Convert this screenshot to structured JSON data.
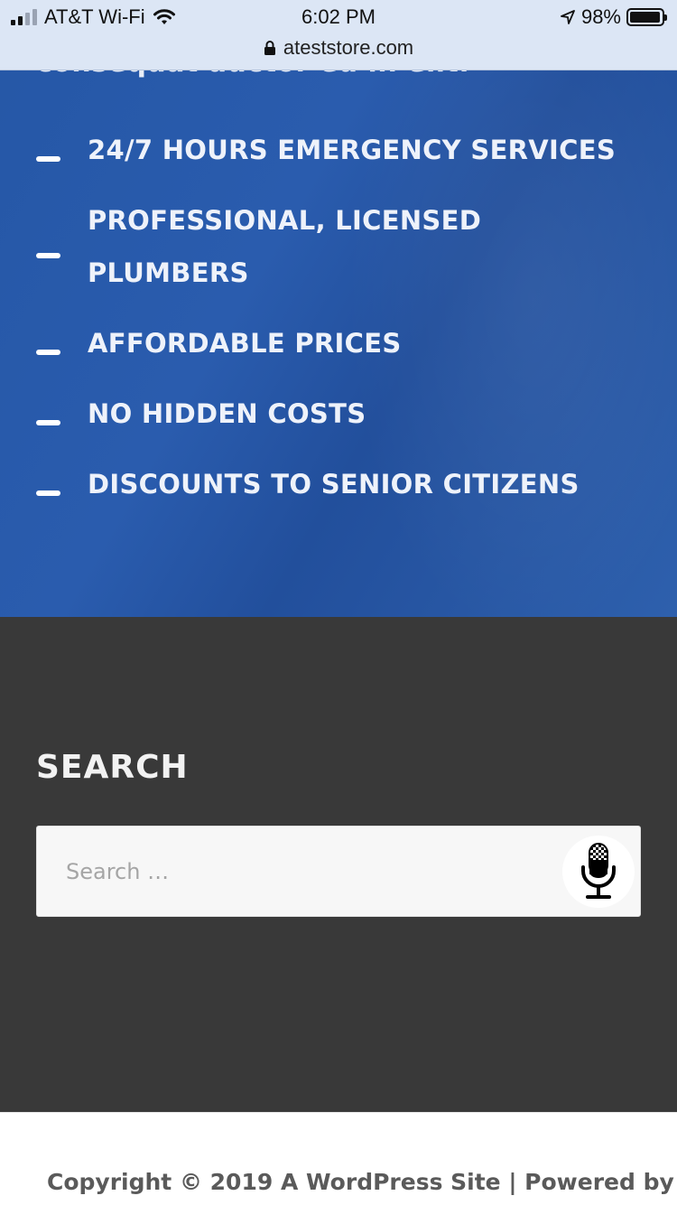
{
  "status_bar": {
    "carrier": "AT&T Wi-Fi",
    "time": "6:02 PM",
    "battery": "98%",
    "battery_level": 0.98,
    "url": "ateststore.com"
  },
  "features": {
    "cut_off_text": "consequat auctor eu in elit.",
    "items": [
      {
        "label": "24/7 HOURS EMERGENCY SERVICES"
      },
      {
        "label": "PROFESSIONAL, LICENSED PLUMBERS"
      },
      {
        "label": "AFFORDABLE PRICES"
      },
      {
        "label": "NO HIDDEN COSTS"
      },
      {
        "label": "DISCOUNTS TO SENIOR CITIZENS"
      }
    ]
  },
  "search": {
    "title": "SEARCH",
    "placeholder": "Search …"
  },
  "footer": {
    "copyright": "Copyright © 2019 A WordPress Site | Powered by"
  },
  "icons": {
    "wifi": "wifi-icon",
    "lock": "lock-icon",
    "location": "location-arrow-icon",
    "microphone": "microphone-icon"
  },
  "colors": {
    "features_bg": "#2557a6",
    "search_bg": "#393939",
    "footer_text": "#5a5a5a"
  }
}
